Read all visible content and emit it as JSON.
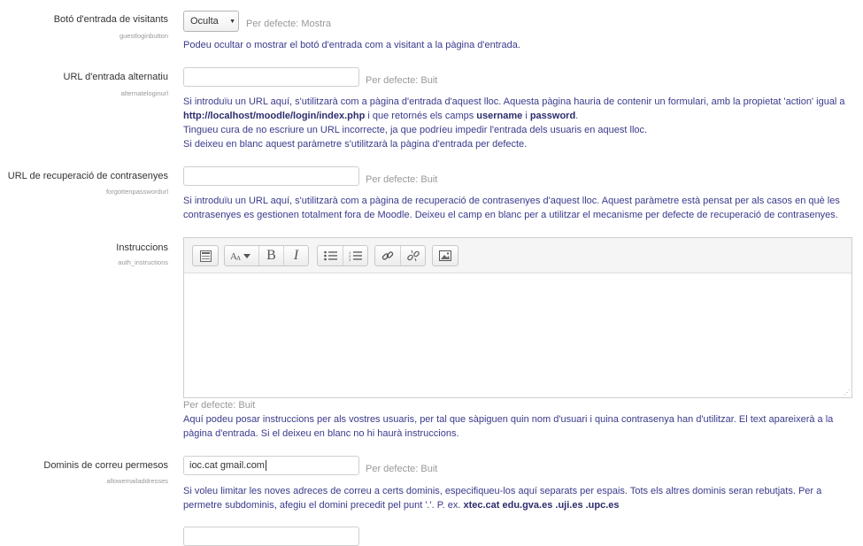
{
  "settings": [
    {
      "label": "Botó d'entrada de visitants",
      "key": "guestloginbutton",
      "select_value": "Oculta",
      "default": "Per defecte: Mostra",
      "desc": "Podeu ocultar o mostrar el botó d'entrada com a visitant a la pàgina d'entrada."
    },
    {
      "label": "URL d'entrada alternatiu",
      "key": "alternateloginurl",
      "value": "",
      "default": "Per defecte: Buit",
      "desc1_a": "Si introduïu un URL aquí, s'utilitzarà com a pàgina d'entrada d'aquest lloc. Aquesta pàgina hauria de contenir un formulari, amb la propietat 'action' igual a",
      "desc1_url": "http://localhost/moodle/login/index.php",
      "desc1_b": " i que retornés els camps ",
      "desc1_user": "username",
      "desc1_c": " i ",
      "desc1_pass": "password",
      "desc1_d": ".",
      "desc2": "Tingueu cura de no escriure un URL incorrecte, ja que podríeu impedir l'entrada dels usuaris en aquest lloc.",
      "desc3": "Si deixeu en blanc aquest paràmetre s'utilitzarà la pàgina d'entrada per defecte."
    },
    {
      "label": "URL de recuperació de contrasenyes",
      "key": "forgottenpasswordurl",
      "value": "",
      "default": "Per defecte: Buit",
      "desc": "Si introduïu un URL aquí, s'utilitzarà com a pàgina de recuperació de contrasenyes d'aquest lloc. Aquest paràmetre està pensat per als casos en què les contrasenyes es gestionen totalment fora de Moodle. Deixeu el camp en blanc per a utilitzar el mecanisme per defecte de recuperació de contrasenyes."
    },
    {
      "label": "Instruccions",
      "key": "auth_instructions",
      "default": "Per defecte: Buit",
      "desc": "Aquí podeu posar instruccions per als vostres usuaris, per tal que sàpiguen quin nom d'usuari i quina contrasenya han d'utilitzar. El text apareixerà a la pàgina d'entrada. Si el deixeu en blanc no hi haurà instruccions."
    },
    {
      "label": "Dominis de correu permesos",
      "key": "allowemailaddresses",
      "value": "ioc.cat gmail.com",
      "default": "Per defecte: Buit",
      "desc_a": "Si voleu limitar les noves adreces de correu a certs dominis, especifiqueu-los aquí separats per espais. Tots els altres dominis seran rebutjats. Per a permetre subdominis, afegiu el domini precedit pel punt '.'. P. ex. ",
      "desc_b": "xtec.cat edu.gva.es .uji.es .upc.es"
    }
  ],
  "editor_toolbar": {
    "icons": [
      "toggle-toolbar-icon",
      "font-style-icon",
      "bold-icon",
      "italic-icon",
      "unordered-list-icon",
      "ordered-list-icon",
      "link-icon",
      "unlink-icon",
      "image-icon"
    ],
    "bold_glyph": "B",
    "italic_glyph": "I"
  }
}
